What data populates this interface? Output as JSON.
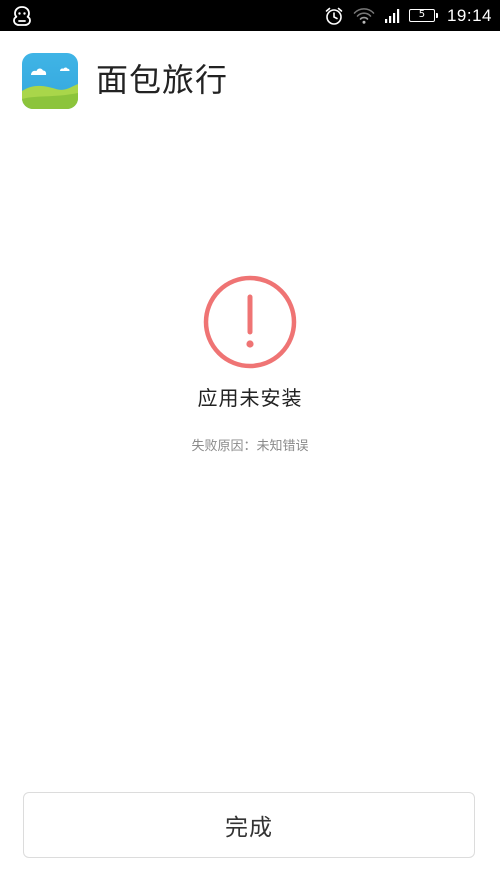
{
  "status_bar": {
    "time": "19:14",
    "battery_level": "5",
    "icons": [
      "notification-app-icon",
      "alarm-icon",
      "wifi-icon",
      "signal-icon",
      "battery-icon"
    ]
  },
  "app": {
    "name": "面包旅行",
    "icon": "breadtrip-app-icon"
  },
  "result": {
    "icon": "exclamation-circle-icon",
    "title": "应用未安装",
    "reason": "失败原因：未知错误",
    "accent_color": "#ef7474"
  },
  "actions": {
    "done_label": "完成"
  }
}
